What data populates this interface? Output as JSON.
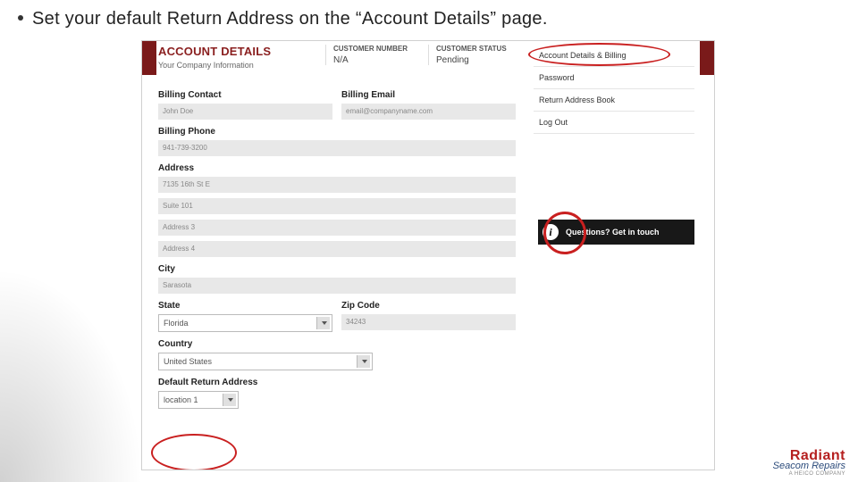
{
  "bullet_text": "Set your default Return Address on the “Account Details” page.",
  "header": {
    "title": "ACCOUNT DETAILS",
    "subtitle": "Your Company Information",
    "custnum_label": "CUSTOMER NUMBER",
    "custnum_value": "N/A",
    "status_label": "CUSTOMER STATUS",
    "status_value": "Pending"
  },
  "form": {
    "billing_contact_label": "Billing Contact",
    "billing_contact_value": "John Doe",
    "billing_email_label": "Billing Email",
    "billing_email_value": "email@companyname.com",
    "billing_phone_label": "Billing Phone",
    "billing_phone_value": "941-739-3200",
    "address_label": "Address",
    "addr1": "7135 16th St E",
    "addr2": "Suite 101",
    "addr3": "Address 3",
    "addr4": "Address 4",
    "city_label": "City",
    "city_value": "Sarasota",
    "state_label": "State",
    "state_value": "Florida",
    "zip_label": "Zip Code",
    "zip_value": "34243",
    "country_label": "Country",
    "country_value": "United States",
    "default_return_label": "Default Return Address",
    "default_return_value": "location 1"
  },
  "sidenav": {
    "i1": "Account Details & Billing",
    "i2": "Password",
    "i3": "Return Address Book",
    "i4": "Log Out"
  },
  "questions_btn": "Questions? Get in touch",
  "info_icon": "i",
  "logo": {
    "line1": "Radiant",
    "line2": "Seacom Repairs",
    "line3": "A HEICO COMPANY"
  }
}
